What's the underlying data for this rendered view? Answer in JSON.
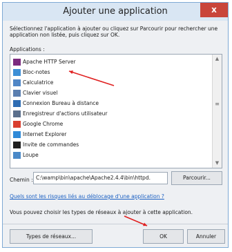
{
  "dialog": {
    "title": "Ajouter une application",
    "close_label": "x",
    "description": "Sélectionnez l'application à ajouter ou cliquez sur Parcourir pour rechercher une application non listée, puis cliquez sur OK.",
    "applications_label": "Applications :",
    "applications": [
      {
        "label": "Apache HTTP Server",
        "icon": "feather-icon",
        "color": "#7b2a7e"
      },
      {
        "label": "Bloc-notes",
        "icon": "notepad-icon",
        "color": "#3d8fd6"
      },
      {
        "label": "Calculatrice",
        "icon": "calculator-icon",
        "color": "#4f86c6"
      },
      {
        "label": "Clavier visuel",
        "icon": "keyboard-icon",
        "color": "#5b7fb0"
      },
      {
        "label": "Connexion Bureau à distance",
        "icon": "remote-desktop-icon",
        "color": "#2f6db3"
      },
      {
        "label": "Enregistreur d'actions utilisateur",
        "icon": "recorder-icon",
        "color": "#5a6f8c"
      },
      {
        "label": "Google Chrome",
        "icon": "chrome-icon",
        "color": "#d93f2f"
      },
      {
        "label": "Internet Explorer",
        "icon": "internet-explorer-icon",
        "color": "#2f8ad8"
      },
      {
        "label": "Invite de commandes",
        "icon": "command-prompt-icon",
        "color": "#1f1f1f"
      },
      {
        "label": "Loupe",
        "icon": "magnifier-icon",
        "color": "#4a89c8"
      }
    ],
    "path_label": "Chemin :",
    "path_value": "C:\\wamp\\bin\\apache\\Apache2.4.4\\bin\\httpd.",
    "browse_label": "Parcourir...",
    "risk_link": "Quels sont les risques liés au déblocage d'une application ?",
    "choose_text": "Vous pouvez choisir les types de réseaux à ajouter à cette application.",
    "network_types_label": "Types de réseaux...",
    "ok_label": "OK",
    "cancel_label": "Annuler",
    "annotation_color": "#e02020"
  }
}
